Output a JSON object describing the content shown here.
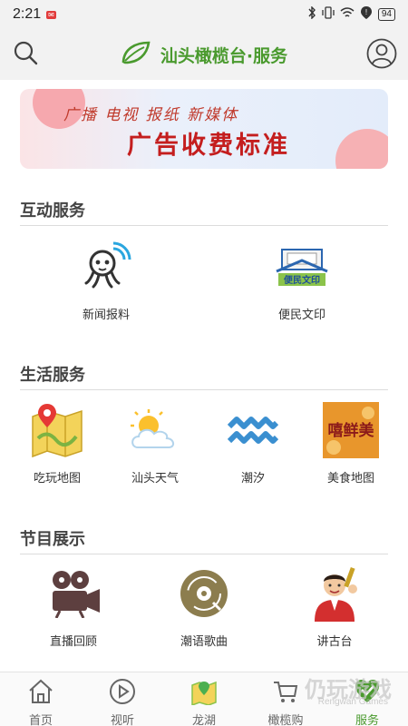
{
  "status_bar": {
    "time": "2:21",
    "battery": "94"
  },
  "header": {
    "title": "汕头橄榄台·服务"
  },
  "banner": {
    "line1": "广播 电视 报纸 新媒体",
    "line2": "广告收费标准"
  },
  "sections": [
    {
      "title": "互动服务",
      "items": [
        {
          "label": "新闻报料",
          "icon": "octopus-icon"
        },
        {
          "label": "便民文印",
          "icon": "print-icon"
        }
      ]
    },
    {
      "title": "生活服务",
      "items": [
        {
          "label": "吃玩地图",
          "icon": "map-icon"
        },
        {
          "label": "汕头天气",
          "icon": "weather-icon"
        },
        {
          "label": "潮汐",
          "icon": "wave-icon"
        },
        {
          "label": "美食地图",
          "icon": "food-icon"
        }
      ]
    },
    {
      "title": "节目展示",
      "items": [
        {
          "label": "直播回顾",
          "icon": "camera-icon"
        },
        {
          "label": "潮语歌曲",
          "icon": "vinyl-icon"
        },
        {
          "label": "讲古台",
          "icon": "storyteller-icon"
        }
      ]
    }
  ],
  "tabs": [
    {
      "label": "首页"
    },
    {
      "label": "视听"
    },
    {
      "label": "龙湖"
    },
    {
      "label": "橄榄购"
    },
    {
      "label": "服务",
      "active": true
    }
  ],
  "watermark": {
    "main": "仍玩游戏",
    "sub": "Rengwan Games"
  },
  "colors": {
    "brand_green": "#4a9a2e",
    "accent_red": "#c41e1e"
  }
}
